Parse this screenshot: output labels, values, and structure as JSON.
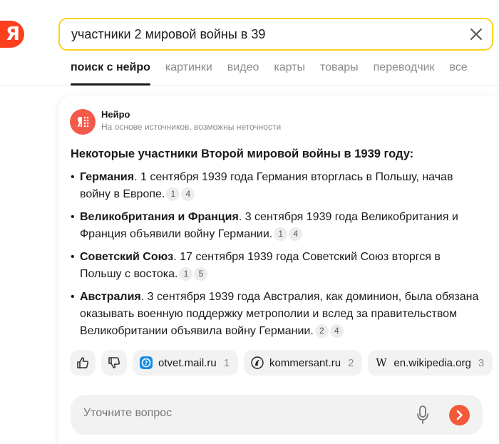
{
  "search": {
    "value": "участники 2 мировой войны в 39",
    "logo_letter": "Я"
  },
  "tabs": [
    {
      "label": "поиск с нейро",
      "active": true
    },
    {
      "label": "картинки"
    },
    {
      "label": "видео"
    },
    {
      "label": "карты"
    },
    {
      "label": "товары"
    },
    {
      "label": "переводчик"
    },
    {
      "label": "все"
    }
  ],
  "neuro": {
    "name": "Нейро",
    "subtitle": "На основе источников, возможны неточности"
  },
  "answer": {
    "title": "Некоторые участники Второй мировой войны в 1939 году:",
    "items": [
      {
        "term": "Германия",
        "text": ". 1 сентября 1939 года Германия вторглась в Польшу, начав войну в Европе.",
        "refs": [
          "1",
          "4"
        ]
      },
      {
        "term": "Великобритания и Франция",
        "text": ". 3 сентября 1939 года Великобритания и Франция объявили войну Германии.",
        "refs": [
          "1",
          "4"
        ]
      },
      {
        "term": "Советский Союз",
        "text": ". 17 сентября 1939 года Советский Союз вторгся в Польшу с востока.",
        "refs": [
          "1",
          "5"
        ]
      },
      {
        "term": "Австралия",
        "text": ". 3 сентября 1939 года Австралия, как доминион, была обязана оказывать военную поддержку метрополии и вслед за правительством Великобритании объявила войну Германии.",
        "refs": [
          "2",
          "4"
        ]
      }
    ]
  },
  "sources": [
    {
      "name": "otvet.mail.ru",
      "count": "1",
      "icon": "otvet-mail-icon"
    },
    {
      "name": "kommersant.ru",
      "count": "2",
      "icon": "kommersant-icon"
    },
    {
      "name": "en.wikipedia.org",
      "count": "3",
      "icon": "wikipedia-icon"
    }
  ],
  "followup": {
    "placeholder": "Уточните вопрос"
  },
  "colors": {
    "accent": "#fcd21d",
    "brand": "#fc3f1d",
    "neuro": "#f25a4a"
  }
}
